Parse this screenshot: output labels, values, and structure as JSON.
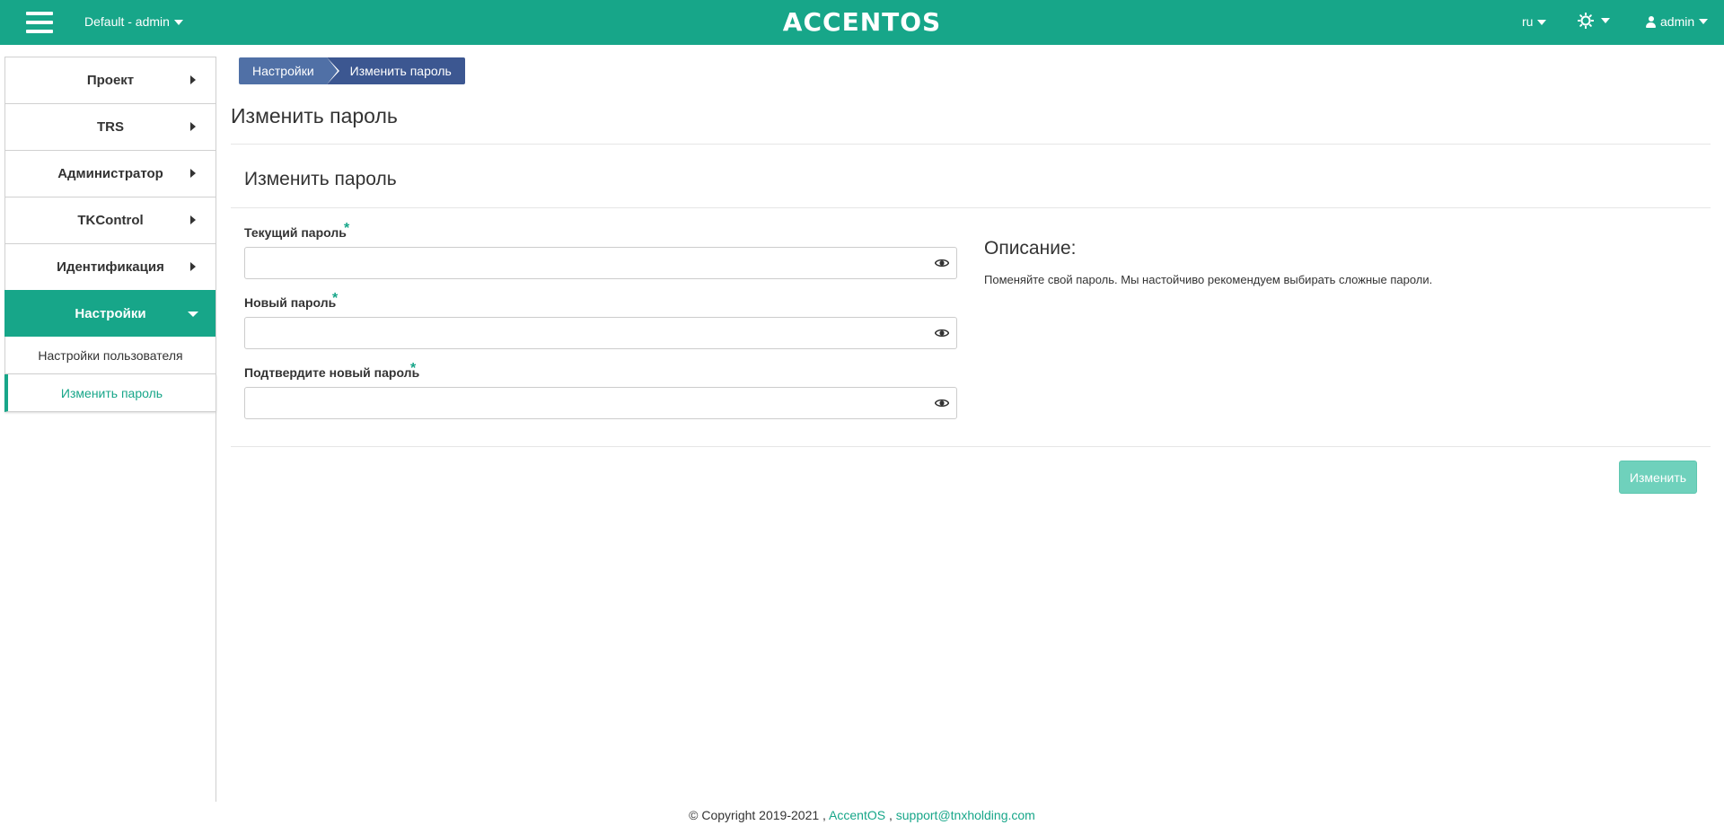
{
  "header": {
    "project_picker": "Default - admin",
    "brand": "ACCENTOS",
    "language": "ru",
    "user": "admin"
  },
  "sidebar": {
    "items": [
      {
        "label": "Проект"
      },
      {
        "label": "TRS"
      },
      {
        "label": "Администратор"
      },
      {
        "label": "TKControl"
      },
      {
        "label": "Идентификация"
      },
      {
        "label": "Настройки"
      }
    ],
    "subitems": [
      {
        "label": "Настройки пользователя"
      },
      {
        "label": "Изменить пароль"
      }
    ]
  },
  "breadcrumb": {
    "items": [
      "Настройки",
      "Изменить пароль"
    ]
  },
  "page": {
    "title": "Изменить пароль",
    "panel_title": "Изменить пароль"
  },
  "form": {
    "fields": [
      {
        "label": "Текущий пароль",
        "required_mark": "*",
        "value": ""
      },
      {
        "label": "Новый пароль",
        "required_mark": "*",
        "value": ""
      },
      {
        "label": "Подтвердите новый пароль",
        "required_mark": "*",
        "value": ""
      }
    ],
    "submit_label": "Изменить"
  },
  "description": {
    "title": "Описание:",
    "text": "Поменяйте свой пароль. Мы настойчиво рекомендуем выбирать сложные пароли."
  },
  "footer": {
    "copyright": "© Copyright 2019-2021 ,",
    "link_name": "AccentOS",
    "separator": ",",
    "link_email": "support@tnxholding.com"
  },
  "colors": {
    "accent": "#17a689",
    "breadcrumb_first": "#5070a6",
    "breadcrumb_second": "#3c5791",
    "submit_disabled": "#6fd1bc"
  }
}
